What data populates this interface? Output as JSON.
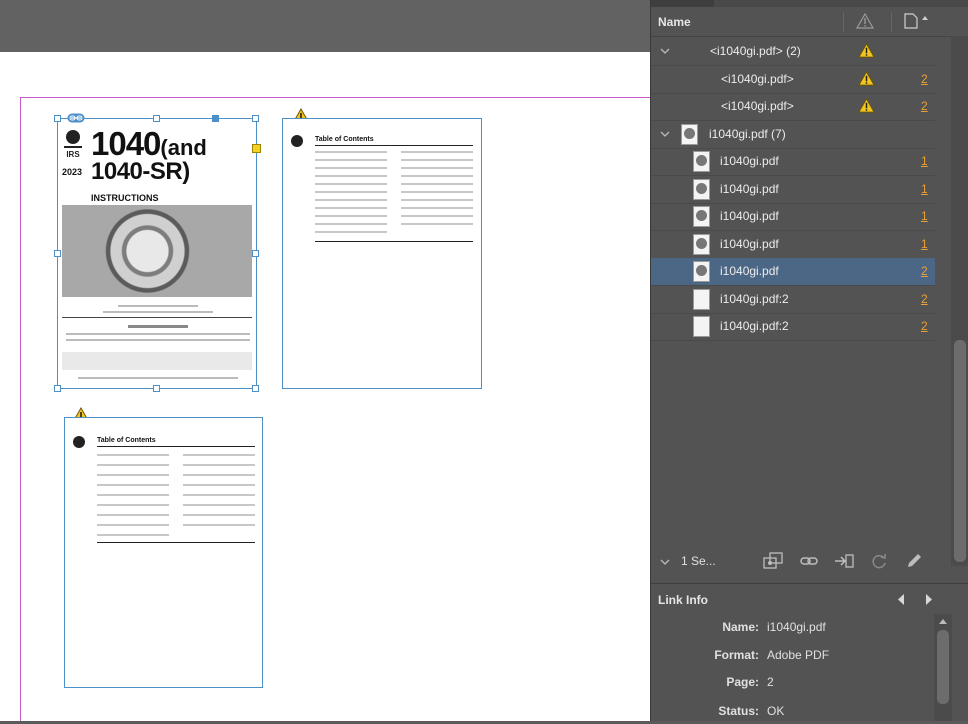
{
  "panel": {
    "header_name": "Name",
    "rows": [
      {
        "label": "<i1040gi.pdf> (2)",
        "num": ""
      },
      {
        "label": "<i1040gi.pdf>",
        "num": "2"
      },
      {
        "label": "<i1040gi.pdf>",
        "num": "2"
      },
      {
        "label": "i1040gi.pdf (7)",
        "num": ""
      },
      {
        "label": "i1040gi.pdf",
        "num": "1"
      },
      {
        "label": "i1040gi.pdf",
        "num": "1"
      },
      {
        "label": "i1040gi.pdf",
        "num": "1"
      },
      {
        "label": "i1040gi.pdf",
        "num": "1"
      },
      {
        "label": "i1040gi.pdf",
        "num": "2"
      },
      {
        "label": "i1040gi.pdf:2",
        "num": "2"
      },
      {
        "label": "i1040gi.pdf:2",
        "num": "2"
      }
    ],
    "selected_label": "1 Se..."
  },
  "link_info": {
    "title": "Link Info",
    "name_key": "Name:",
    "name_val": "i1040gi.pdf",
    "format_key": "Format:",
    "format_val": "Adobe PDF",
    "page_key": "Page:",
    "page_val": "2",
    "status_key": "Status:",
    "status_val": "OK"
  },
  "document": {
    "p1_title": "1040",
    "p1_title_suffix": "(and",
    "p1_sub": "1040-SR)",
    "p1_instr": "INSTRUCTIONS",
    "p1_year": "2023",
    "irs": "IRS",
    "toc_title": "Table of Contents"
  },
  "colors": {
    "accent_number": "#e8a038",
    "selection": "#4b6785",
    "frame": "#4d90c8",
    "margin_guide": "#c85ac8"
  }
}
